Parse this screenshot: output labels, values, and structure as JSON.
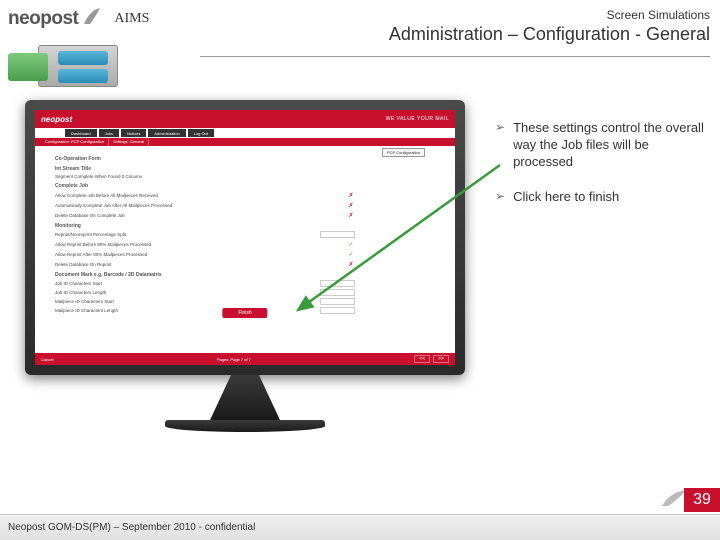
{
  "header": {
    "brand": "neopost",
    "product": "AIMS",
    "category": "Screen Simulations",
    "title": "Administration – Configuration  - General"
  },
  "monitor": {
    "topbar": {
      "logo": "neopost",
      "tagline": "WE VALUE YOUR MAIL"
    },
    "nav": [
      "Dashboard",
      "Jobs",
      "Notices",
      "Administration",
      "Log Out"
    ],
    "subnav": [
      "Configuration: PCP Configuration",
      "Settings: General"
    ],
    "pcp_button": "PCP Configuration",
    "sections": {
      "coop": "Co-Operation Form",
      "intstream": "Int Stream Title",
      "segcomp": "Segment Complete When Found 0 Circumv"
    },
    "complete_job": {
      "title": "Complete Job",
      "lines": [
        "Allow Complete Job Before All Mailpieces Received",
        "Automatically Complete Job After All Mailpieces Processed",
        "Delete Database On Complete Job"
      ]
    },
    "monitoring": {
      "title": "Monitoring",
      "lines": [
        "Reprint/Nonreprint Percentage Split",
        "Allow Reprint Before 80% Mailpieces Processed",
        "Allow Reprint After 80% Mailpieces Processed",
        "Delete Database On Reprint"
      ]
    },
    "docmark": {
      "title": "Document Mark e.g. Barcode / 2D Datamatrix",
      "lines": [
        "Job ID Characters Start",
        "Job ID Characters Length",
        "Mailpiece ID Characters Start",
        "Mailpiece ID Characters Length"
      ]
    },
    "finish": "Finish",
    "footer": {
      "cancel": "Cancel",
      "pages": "Pages: Page 7 of 7",
      "prev": "<<",
      "next": ">>"
    }
  },
  "bullets": [
    "These settings control the overall way the Job files will be processed",
    "Click here to finish"
  ],
  "page_number": "39",
  "footer": "Neopost GOM-DS(PM) – September 2010 - confidential"
}
